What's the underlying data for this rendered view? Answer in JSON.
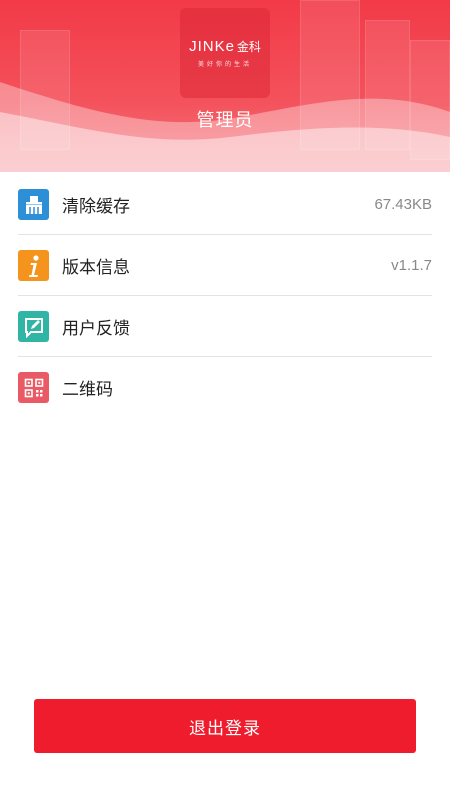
{
  "header": {
    "logo_en": "JINKe",
    "logo_cn": "金科",
    "logo_slogan": "美好你的生活",
    "title": "管理员",
    "brand_color": "#f23a48"
  },
  "menu": [
    {
      "label": "清除缓存",
      "value": "67.43KB",
      "icon": "broom-icon",
      "icon_color": "#2d8fd5"
    },
    {
      "label": "版本信息",
      "value": "v1.1.7",
      "icon": "info-icon",
      "icon_color": "#f5941d"
    },
    {
      "label": "用户反馈",
      "value": "",
      "icon": "feedback-edit-icon",
      "icon_color": "#2fb4a5"
    },
    {
      "label": "二维码",
      "value": "",
      "icon": "qr-code-icon",
      "icon_color": "#ea5a64"
    }
  ],
  "logout": {
    "label": "退出登录",
    "color": "#ee1c2c"
  }
}
